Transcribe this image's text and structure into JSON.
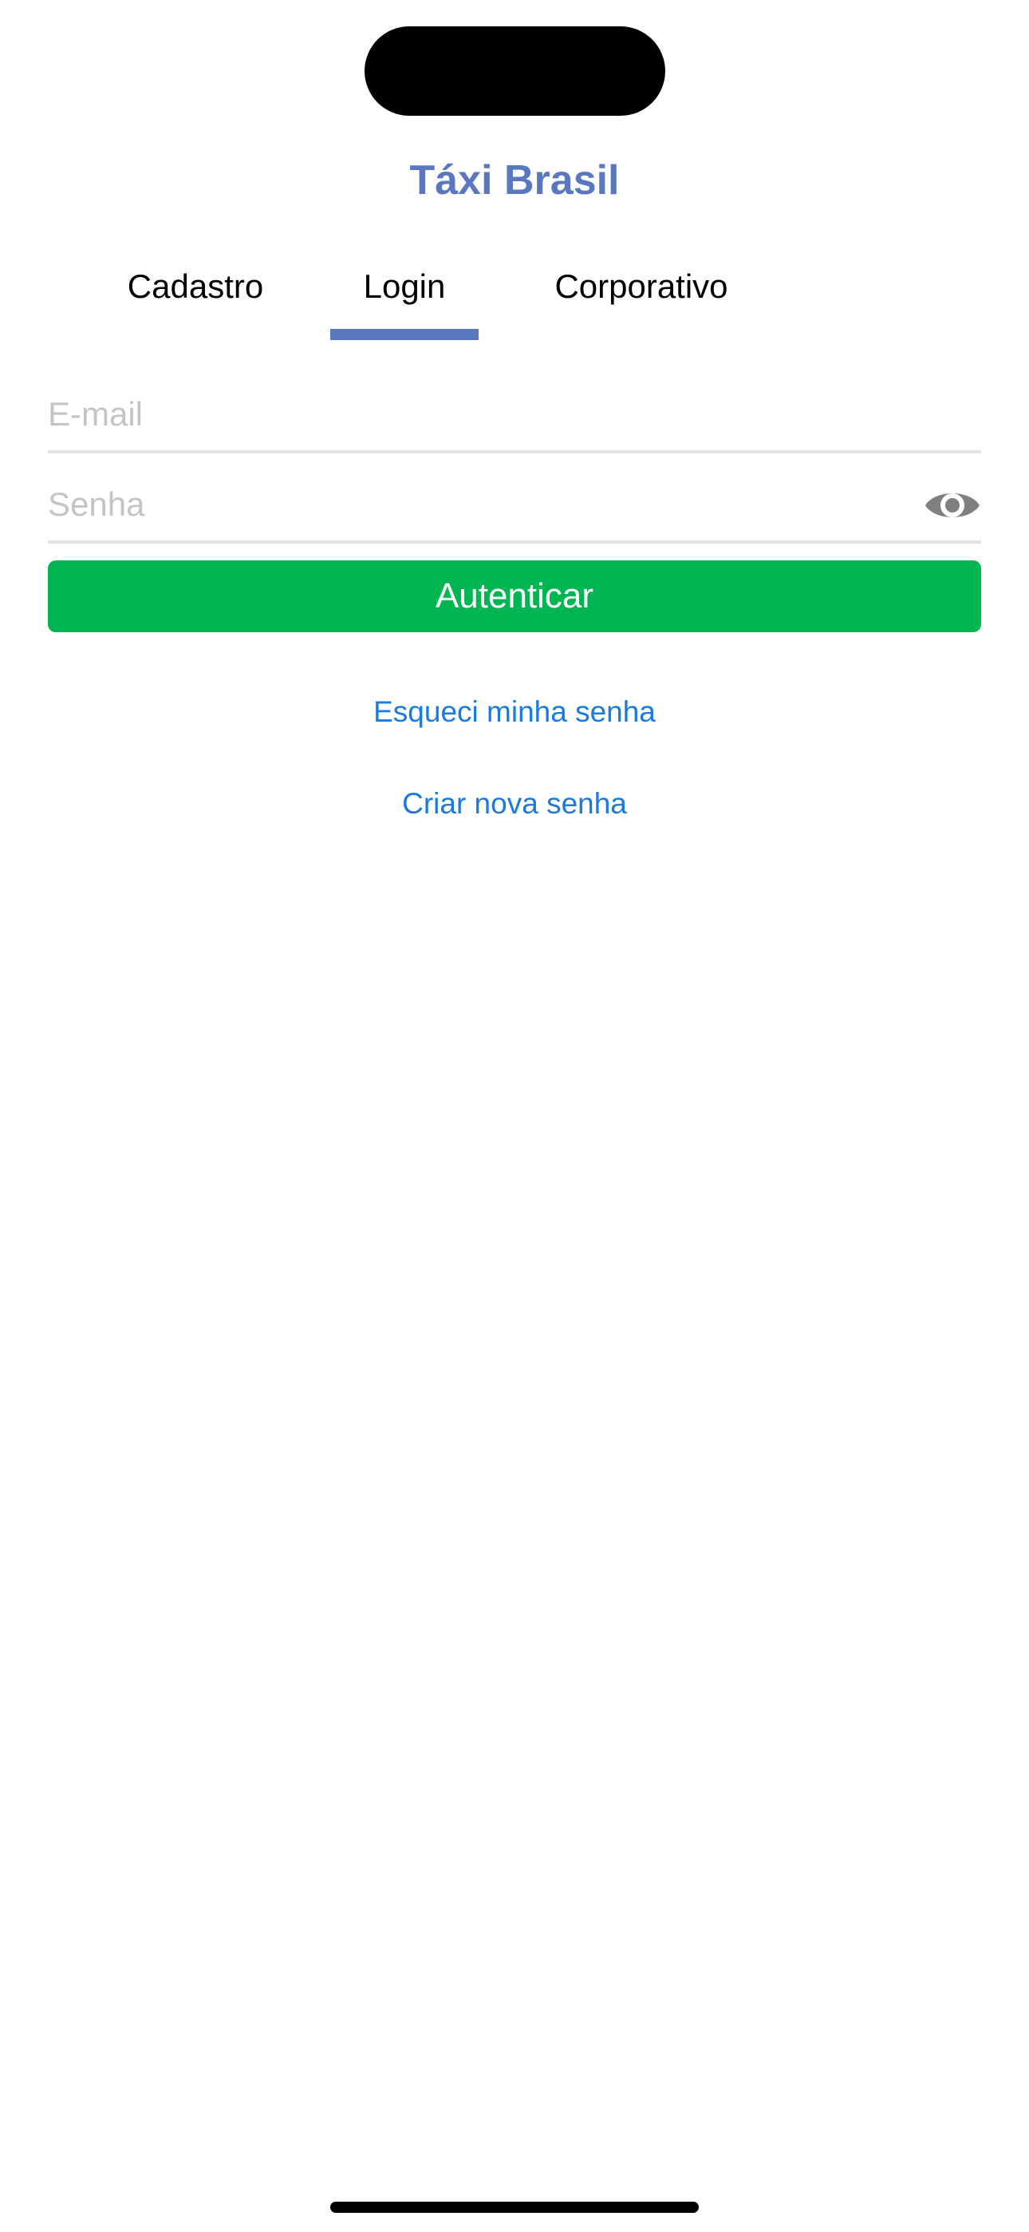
{
  "app": {
    "title": "Táxi Brasil",
    "accent_color": "#5a78bf"
  },
  "tabs": [
    {
      "label": "Cadastro",
      "active": false
    },
    {
      "label": "Login",
      "active": true
    },
    {
      "label": "Corporativo",
      "active": false
    }
  ],
  "form": {
    "email": {
      "value": "",
      "placeholder": "E-mail"
    },
    "password": {
      "value": "",
      "placeholder": "Senha",
      "toggle_icon": "eye-icon"
    },
    "submit_label": "Autenticar",
    "submit_color": "#00b653"
  },
  "links": {
    "forgot_password": "Esqueci minha senha",
    "create_password": "Criar nova senha",
    "link_color": "#1a7ae0"
  }
}
